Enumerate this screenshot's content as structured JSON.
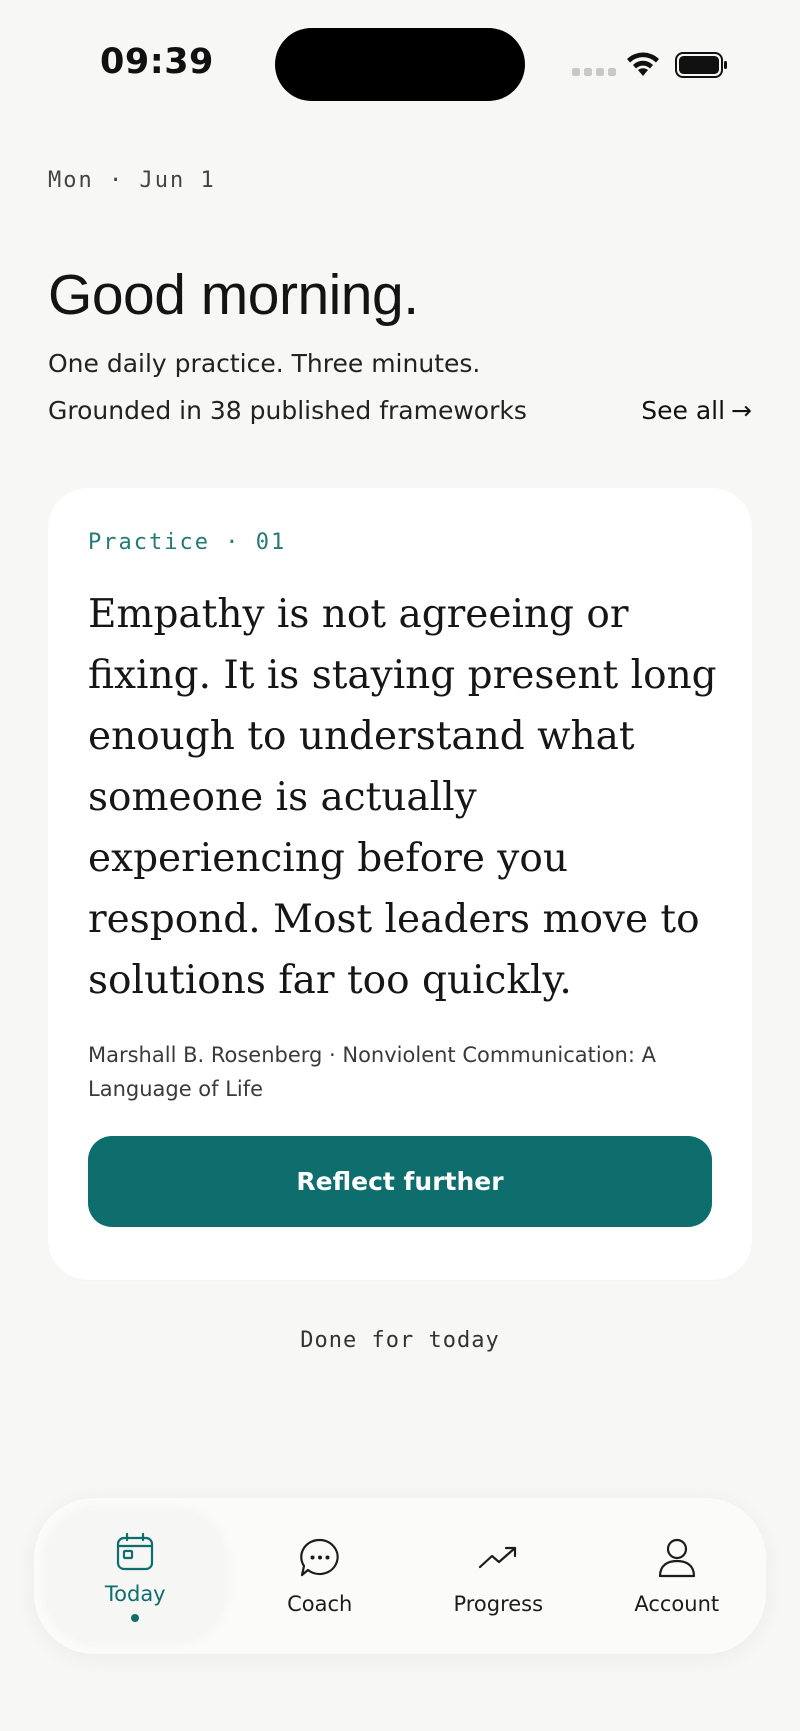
{
  "status_bar": {
    "time": "09:39"
  },
  "header": {
    "date": "Mon · Jun 1",
    "greeting": "Good morning.",
    "subtitle": "One daily practice. Three minutes.",
    "frameworks_text": "Grounded in 38 published frameworks",
    "see_all_label": "See all",
    "see_all_arrow": "→"
  },
  "practice_card": {
    "label": "Practice · 01",
    "quote": "Empathy is not agreeing or fixing. It is staying present long enough to understand what someone is actually experiencing before you respond. Most leaders move to solutions far too quickly.",
    "citation": "Marshall B. Rosenberg · Nonviolent Communication: A Language of Life",
    "button_label": "Reflect further"
  },
  "done_label": "Done for today",
  "tab_bar": {
    "tabs": [
      {
        "label": "Today",
        "icon": "calendar-icon",
        "active": true
      },
      {
        "label": "Coach",
        "icon": "chat-bubble-icon",
        "active": false
      },
      {
        "label": "Progress",
        "icon": "trend-up-icon",
        "active": false
      },
      {
        "label": "Account",
        "icon": "person-icon",
        "active": false
      }
    ]
  },
  "colors": {
    "accent": "#0e6e6e",
    "label_teal": "#237a76",
    "background": "#f7f7f5",
    "card": "#ffffff"
  }
}
